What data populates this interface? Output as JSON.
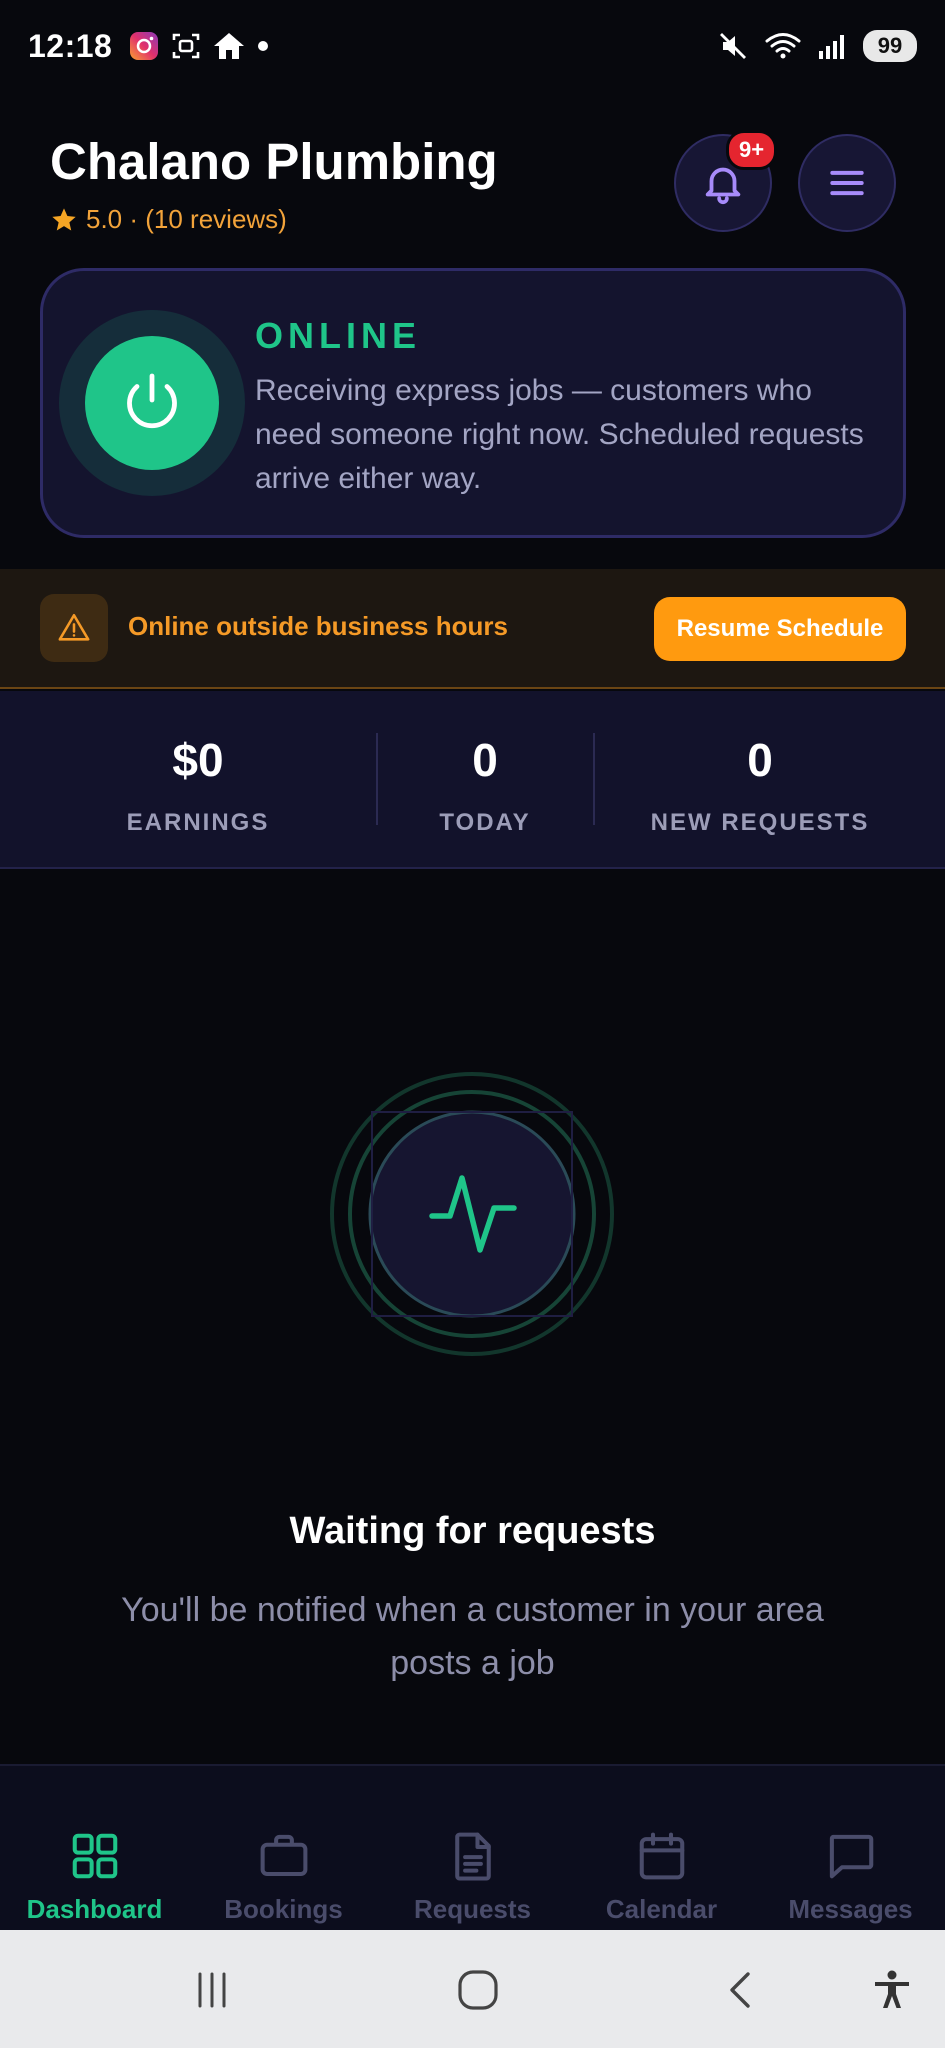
{
  "status_bar": {
    "time": "12:18",
    "battery": "99",
    "left_icons": [
      "instagram-icon",
      "screenshot-icon",
      "home-icon",
      "dot"
    ],
    "right_icons": [
      "mute-icon",
      "wifi-icon",
      "signal-icon"
    ]
  },
  "header": {
    "business_name": "Chalano Plumbing",
    "rating_text": "5.0 · (10 reviews)",
    "notification_badge": "9+"
  },
  "online_card": {
    "status_label": "ONLINE",
    "description": "Receiving express jobs — customers who need someone right now. Scheduled requests arrive either way."
  },
  "warning_banner": {
    "message": "Online outside business hours",
    "action_label": "Resume Schedule"
  },
  "stats": [
    {
      "value": "$0",
      "label": "EARNINGS"
    },
    {
      "value": "0",
      "label": "TODAY"
    },
    {
      "value": "0",
      "label": "NEW REQUESTS"
    }
  ],
  "waiting": {
    "title": "Waiting for requests",
    "subtitle": "You'll be notified when a customer in your area posts a job"
  },
  "bottom_nav": [
    {
      "label": "Dashboard",
      "icon": "grid-icon",
      "active": true
    },
    {
      "label": "Bookings",
      "icon": "briefcase-icon",
      "active": false
    },
    {
      "label": "Requests",
      "icon": "document-icon",
      "active": false
    },
    {
      "label": "Calendar",
      "icon": "calendar-icon",
      "active": false
    },
    {
      "label": "Messages",
      "icon": "chat-icon",
      "active": false
    }
  ],
  "colors": {
    "accent_green": "#1fc589",
    "accent_orange": "#ff9a0f",
    "badge_red": "#e5252f",
    "purple": "#a78bfa",
    "background": "#07080d"
  }
}
